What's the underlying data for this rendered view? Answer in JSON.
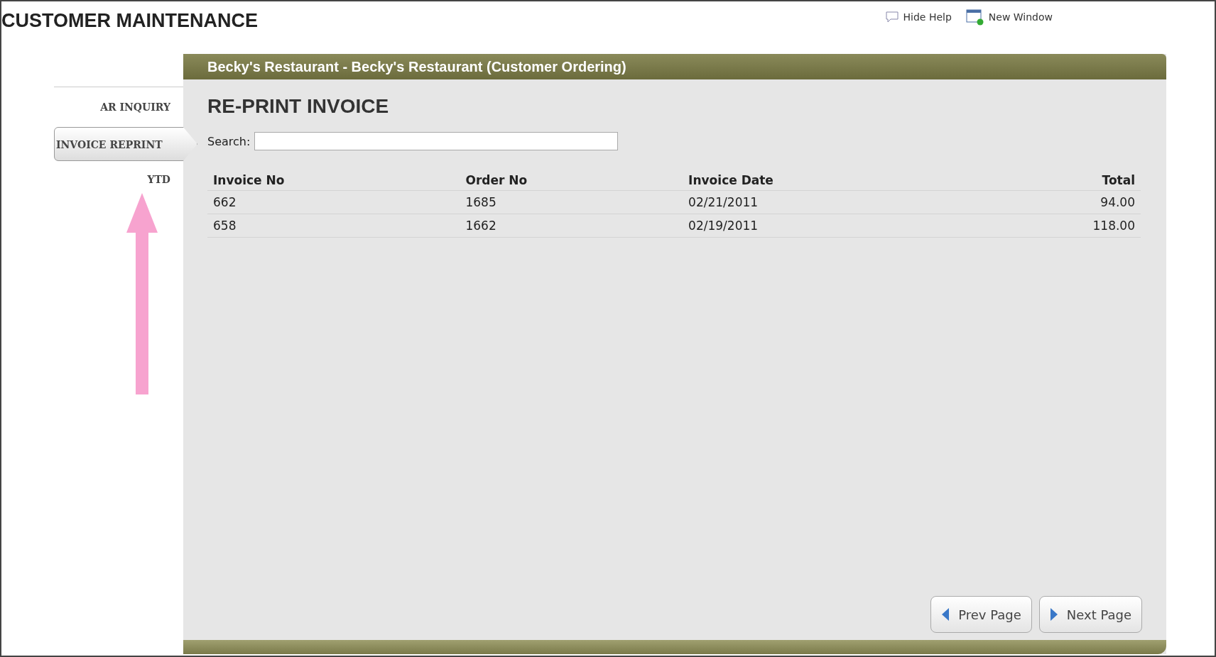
{
  "page_title": "CUSTOMER MAINTENANCE",
  "top_links": [
    {
      "kind": "help",
      "label": "Hide Help"
    },
    {
      "kind": "window",
      "label": "New Window"
    }
  ],
  "sidebar": {
    "items": [
      {
        "label": "AR INQUIRY",
        "selected": false
      },
      {
        "label": "INVOICE REPRINT",
        "selected": true
      },
      {
        "label": "YTD",
        "selected": false
      }
    ]
  },
  "panel": {
    "header": "Becky's Restaurant - Becky's Restaurant (Customer Ordering)",
    "title": "RE-PRINT INVOICE"
  },
  "search": {
    "label": "Search:"
  },
  "table": {
    "columns": [
      "Invoice No",
      "Order No",
      "Invoice Date",
      "Total"
    ],
    "rows": [
      [
        "662",
        "1685",
        "02/21/2011",
        "94.00"
      ],
      [
        "658",
        "1662",
        "02/19/2011",
        "118.00"
      ]
    ]
  },
  "buttons": [
    {
      "kind": "prev",
      "label": "Prev Page"
    },
    {
      "kind": "next",
      "label": "Next Page"
    }
  ]
}
